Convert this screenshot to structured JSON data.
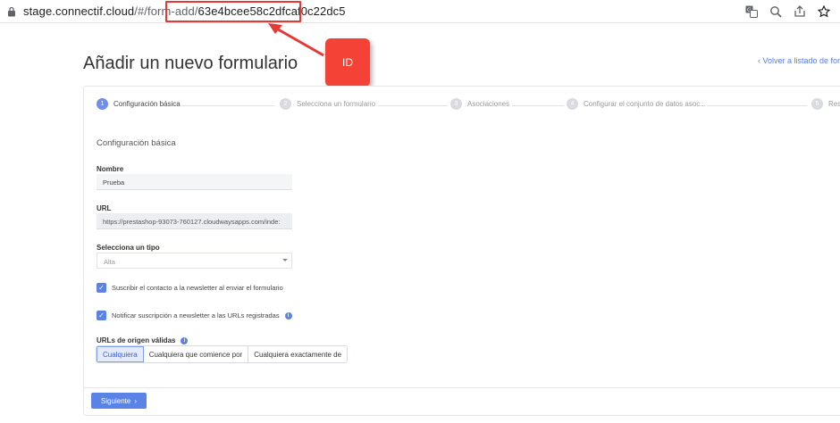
{
  "browser": {
    "url_host": "stage.connectif.cloud",
    "url_path": "/#/form-add/",
    "url_id": "63e4bcee58c2dfcaf0c22dc5",
    "icons": [
      "translate-icon",
      "zoom-icon",
      "share-icon",
      "star-icon"
    ]
  },
  "annotation": {
    "callout_label": "ID",
    "color": "#f44336"
  },
  "page": {
    "title": "Añadir un nuevo formulario",
    "back_link": "‹  Volver a listado de for"
  },
  "steps": [
    {
      "num": "1",
      "label": "Configuración básica",
      "active": true
    },
    {
      "num": "2",
      "label": "Selecciona un formulario",
      "active": false
    },
    {
      "num": "3",
      "label": "Asociaciones",
      "active": false
    },
    {
      "num": "4",
      "label": "Configurar el conjunto de datos asoc...",
      "active": false
    },
    {
      "num": "5",
      "label": "Res",
      "active": false
    }
  ],
  "form": {
    "section_title": "Configuración básica",
    "name_label": "Nombre",
    "name_value": "Prueba",
    "url_label": "URL",
    "url_value": "https://prestashop-93073-760127.cloudwaysapps.com/inde:",
    "type_label": "Selecciona un tipo",
    "type_value": "Alta",
    "newsletter_check": "Suscribir el contacto a la newsletter al enviar el formulario",
    "notify_check": "Notificar suscripción a newsletter a las URLs registradas",
    "origin_label": "URLs de origen válidas",
    "origin_options": [
      "Cualquiera",
      "Cualquiera que comience por",
      "Cualquiera exactamente de"
    ],
    "origin_selected": "Cualquiera"
  },
  "footer": {
    "next_label": "Siguiente",
    "next_chevron": "›"
  },
  "colors": {
    "accent": "#5b83e6",
    "highlight": "#e53935"
  }
}
